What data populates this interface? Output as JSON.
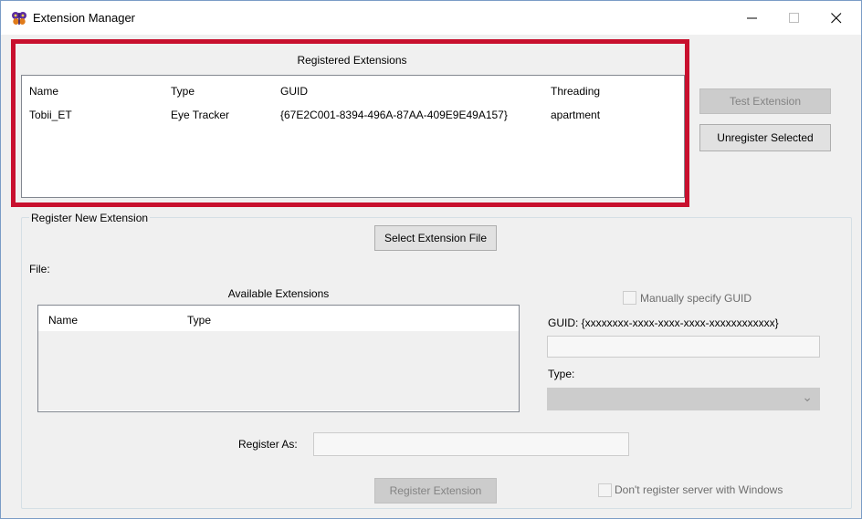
{
  "window": {
    "title": "Extension Manager",
    "minimize_symbol": "—",
    "maximize_symbol": "☐",
    "close_symbol": "✕"
  },
  "registered": {
    "title": "Registered Extensions",
    "columns": [
      "Name",
      "Type",
      "GUID",
      "Threading"
    ],
    "rows": [
      [
        "Tobii_ET",
        "Eye Tracker",
        "{67E2C001-8394-496A-87AA-409E9E49A157}",
        "apartment"
      ]
    ]
  },
  "buttons": {
    "test_extension": "Test Extension",
    "unregister_selected": "Unregister Selected",
    "select_extension_file": "Select Extension File",
    "register_extension": "Register Extension"
  },
  "register_new": {
    "group_label": "Register New Extension",
    "file_label": "File:",
    "available_title": "Available Extensions",
    "available_columns": [
      "Name",
      "Type"
    ],
    "manual_guid_label": "Manually specify GUID",
    "guid_label": "GUID: {xxxxxxxx-xxxx-xxxx-xxxx-xxxxxxxxxxxx}",
    "type_label": "Type:",
    "register_as_label": "Register As:",
    "dont_register_label": "Don't register server with Windows",
    "combo_arrow": "⌄"
  },
  "colors": {
    "highlight": "#c8102e",
    "window_bg": "#f0f0f0"
  },
  "icons": {
    "app": "app-butterfly-icon"
  }
}
